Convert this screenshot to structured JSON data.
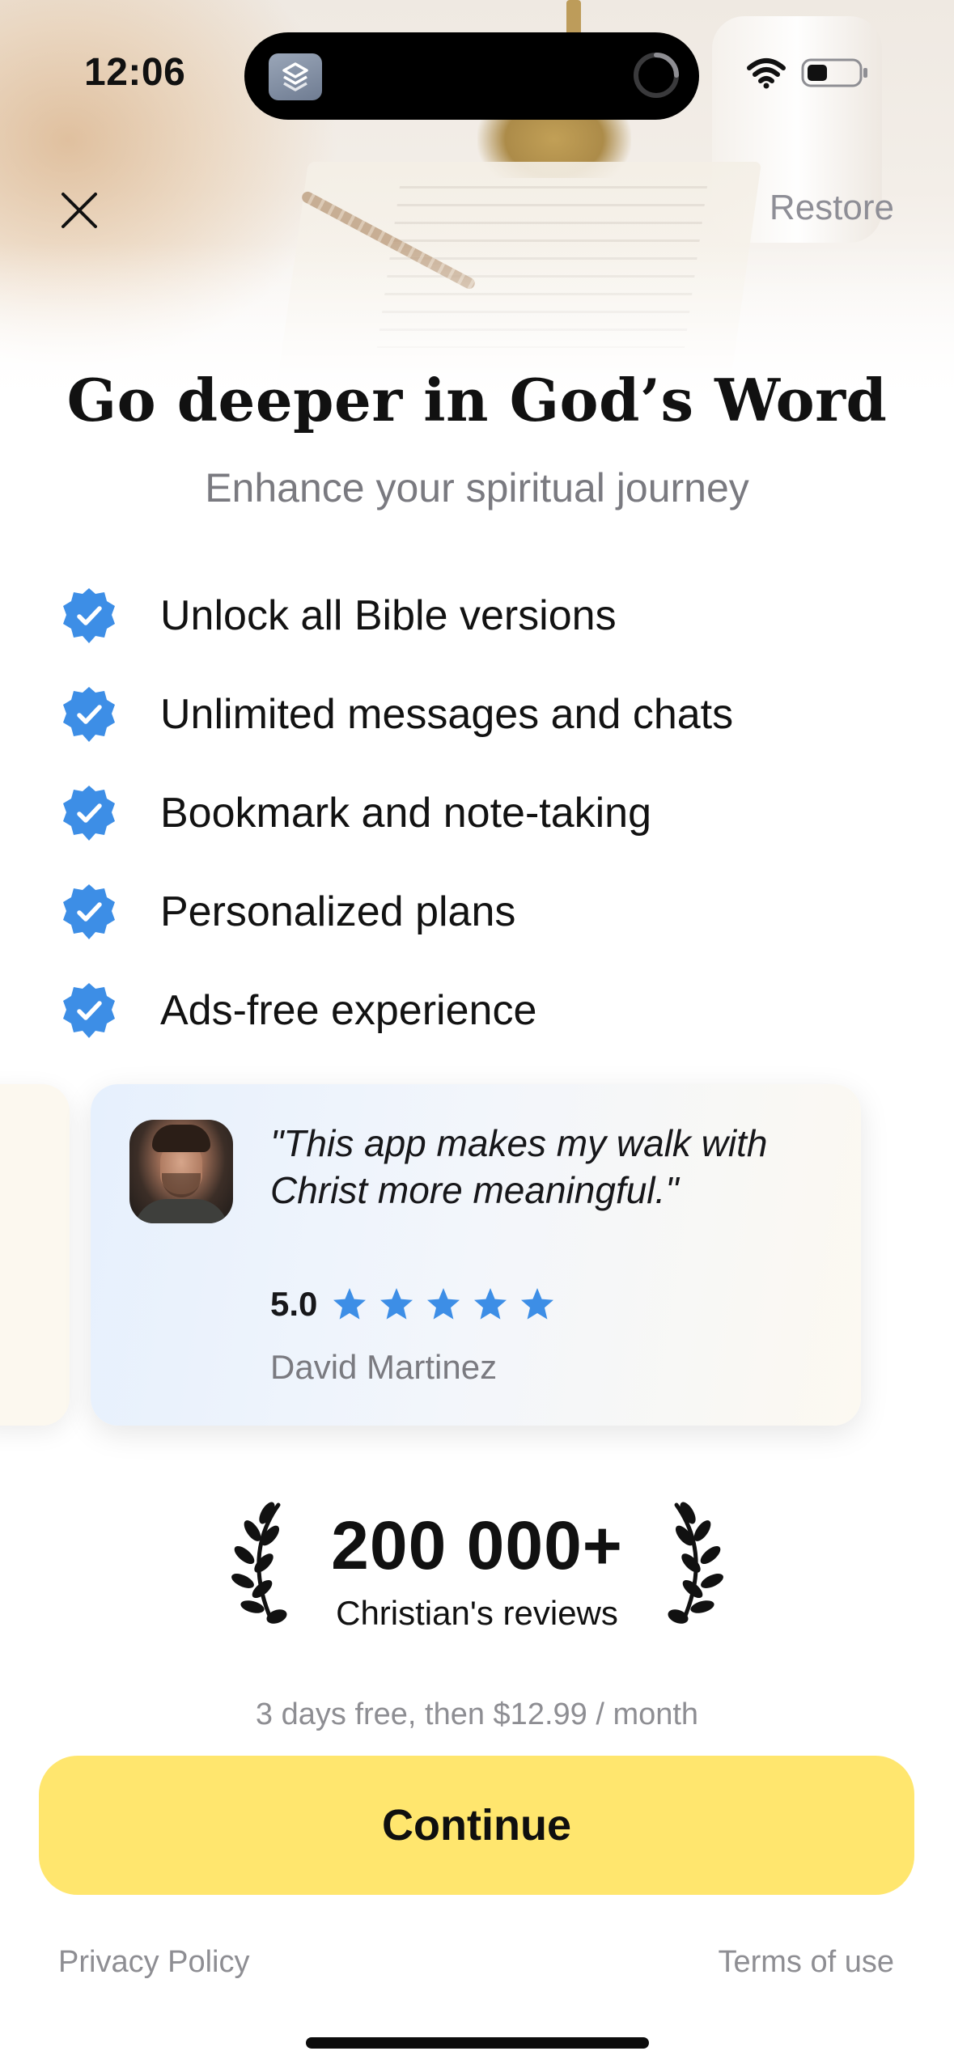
{
  "status_bar": {
    "time": "12:06",
    "icons": [
      "shortcuts-app-icon",
      "activity-spinner-icon",
      "wifi-icon",
      "battery-icon"
    ]
  },
  "top_bar": {
    "close_icon": "close-icon",
    "restore_label": "Restore"
  },
  "header": {
    "title": "Go deeper in God’s Word",
    "subtitle": "Enhance your spiritual journey"
  },
  "features": [
    {
      "icon": "verified-check-icon",
      "label": "Unlock all Bible versions"
    },
    {
      "icon": "verified-check-icon",
      "label": "Unlimited messages and chats"
    },
    {
      "icon": "verified-check-icon",
      "label": "Bookmark and note-taking"
    },
    {
      "icon": "verified-check-icon",
      "label": "Personalized plans"
    },
    {
      "icon": "verified-check-icon",
      "label": "Ads-free experience"
    }
  ],
  "review": {
    "quote": "\"This app makes my walk with Christ more meaningful.\"",
    "rating": "5.0",
    "stars": 5,
    "reviewer": "David Martinez"
  },
  "social_proof": {
    "count": "200 000+",
    "label": "Christian's reviews",
    "icon": "laurel-icon"
  },
  "pricing": {
    "text": "3 days free, then $12.99 / month"
  },
  "cta": {
    "label": "Continue"
  },
  "footer": {
    "privacy_label": "Privacy Policy",
    "terms_label": "Terms of use"
  },
  "colors": {
    "accent_blue": "#3d8ee6",
    "cta_yellow": "#ffe66e",
    "muted_text": "#8e8e93",
    "star_blue": "#3d8ee6"
  }
}
